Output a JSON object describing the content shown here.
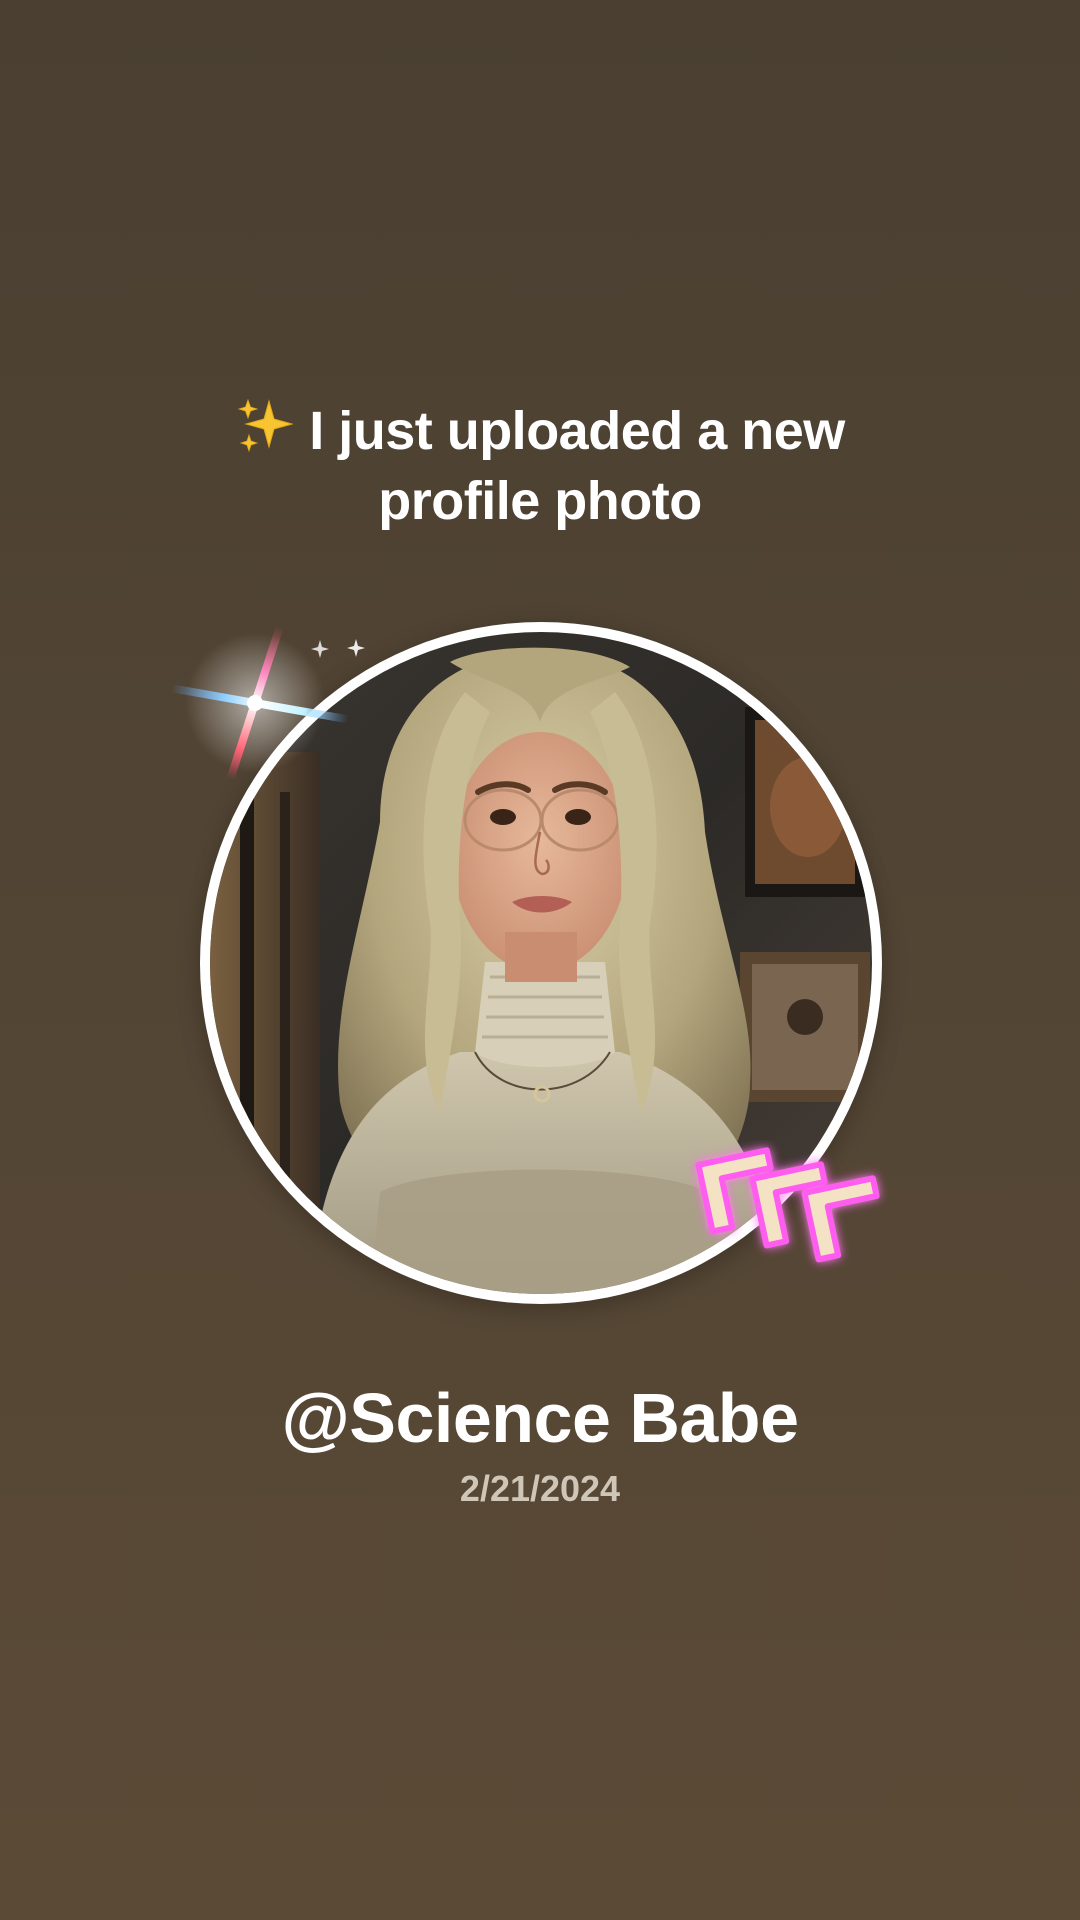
{
  "headline": {
    "emoji": "sparkles-icon",
    "line1": "I just uploaded a new",
    "line2": "profile photo"
  },
  "profile": {
    "username": "@Science Babe",
    "date": "2/21/2024"
  },
  "colors": {
    "background": "#4f4333",
    "ring": "#ffffff",
    "date_text": "#cfc6b8",
    "neon_pink": "#ff5cf0"
  }
}
